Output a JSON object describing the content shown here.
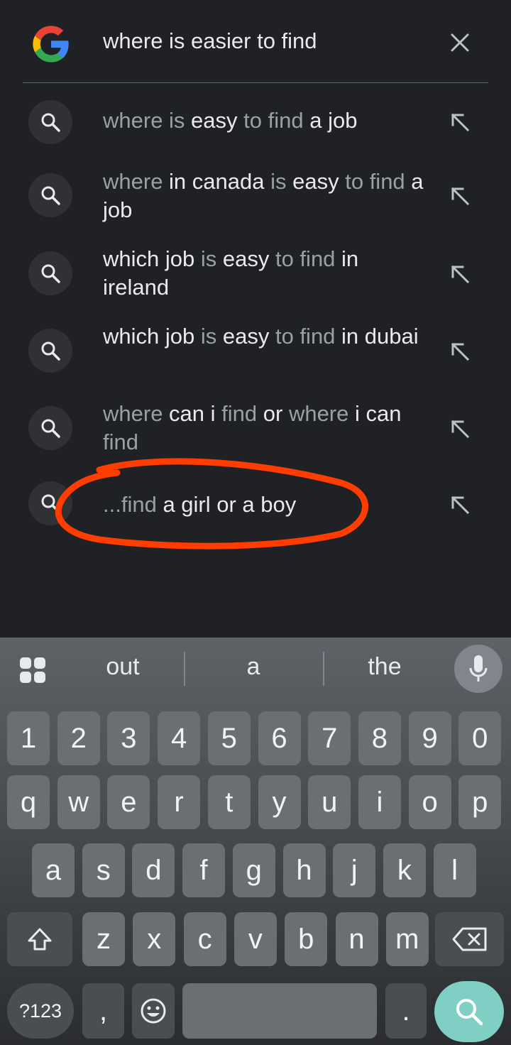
{
  "search": {
    "query": "where is easier to find"
  },
  "suggestions": [
    {
      "parts": [
        {
          "t": "where is ",
          "b": false
        },
        {
          "t": "easy",
          "b": true
        },
        {
          "t": " to find ",
          "b": false
        },
        {
          "t": "a job",
          "b": true
        }
      ]
    },
    {
      "parts": [
        {
          "t": "where ",
          "b": false
        },
        {
          "t": "in canada",
          "b": true
        },
        {
          "t": " is ",
          "b": false
        },
        {
          "t": "easy",
          "b": true
        },
        {
          "t": " to find ",
          "b": false
        },
        {
          "t": "a job",
          "b": true
        }
      ]
    },
    {
      "parts": [
        {
          "t": "which job",
          "b": true
        },
        {
          "t": " is ",
          "b": false
        },
        {
          "t": "easy",
          "b": true
        },
        {
          "t": " to find ",
          "b": false
        },
        {
          "t": "in ireland",
          "b": true
        }
      ]
    },
    {
      "parts": [
        {
          "t": "which job",
          "b": true
        },
        {
          "t": " is ",
          "b": false
        },
        {
          "t": "easy",
          "b": true
        },
        {
          "t": " to find ",
          "b": false
        },
        {
          "t": "in dubai",
          "b": true
        }
      ]
    },
    {
      "parts": [
        {
          "t": "where ",
          "b": false
        },
        {
          "t": "can i",
          "b": true
        },
        {
          "t": " find ",
          "b": false
        },
        {
          "t": "or",
          "b": true
        },
        {
          "t": " where ",
          "b": false
        },
        {
          "t": "i can",
          "b": true
        },
        {
          "t": " find",
          "b": false
        }
      ]
    },
    {
      "parts": [
        {
          "t": "...find",
          "b": false
        },
        {
          "t": " a girl or a boy",
          "b": true
        }
      ]
    }
  ],
  "keyboard": {
    "suggestions": [
      "out",
      "a",
      "the"
    ],
    "row_numbers": [
      "1",
      "2",
      "3",
      "4",
      "5",
      "6",
      "7",
      "8",
      "9",
      "0"
    ],
    "row1": [
      "q",
      "w",
      "e",
      "r",
      "t",
      "y",
      "u",
      "i",
      "o",
      "p"
    ],
    "row2": [
      "a",
      "s",
      "d",
      "f",
      "g",
      "h",
      "j",
      "k",
      "l"
    ],
    "row3": [
      "z",
      "x",
      "c",
      "v",
      "b",
      "n",
      "m"
    ],
    "symbols_label": "?123",
    "comma": ",",
    "period": "."
  },
  "colors": {
    "background": "#202124",
    "annotation": "#ff3d00",
    "enter_key": "#7fcfc4"
  },
  "icons": {
    "logo": "google-g-logo",
    "clear": "close-icon",
    "suggestion": "search-icon",
    "fill": "arrow-up-left-icon",
    "apps": "apps-grid-icon",
    "mic": "microphone-icon",
    "shift": "shift-icon",
    "backspace": "backspace-icon",
    "emoji": "emoji-icon",
    "enter": "search-icon"
  }
}
